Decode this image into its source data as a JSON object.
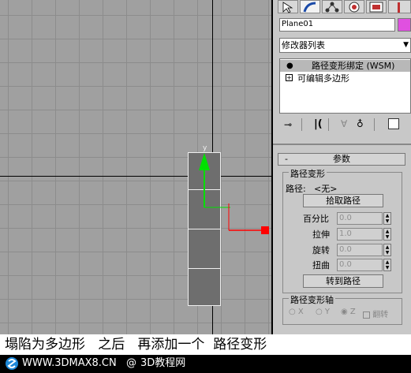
{
  "panel": {
    "object_name": "Plane01",
    "object_color": "#e050e0",
    "modifier_list_label": "修改器列表",
    "stack": [
      {
        "label": "路径变形绑定 (WSM)",
        "selected": true
      },
      {
        "label": "可编辑多边形",
        "selected": false
      }
    ],
    "rollout_title": "参数",
    "rollout_toggle": "-",
    "group_path_deform": "路径变形",
    "path_label": "路径:",
    "path_value": "<无>",
    "pick_path_button": "拾取路径",
    "percent_label": "百分比",
    "percent_value": "0.0",
    "stretch_label": "拉伸",
    "stretch_value": "1.0",
    "rotation_label": "旋转",
    "rotation_value": "0.0",
    "twist_label": "扭曲",
    "twist_value": "0.0",
    "goto_path_button": "转到路径",
    "group_axis": "路径变形轴",
    "axis_x": "X",
    "axis_y": "Y",
    "axis_z": "Z",
    "axis_selected": "Z",
    "flip_label": "翻转"
  },
  "viewport": {
    "gizmo_y_label": "y",
    "colors": {
      "y_axis": "#00e000",
      "x_axis": "#ff0000",
      "object": "#6e6e6e"
    }
  },
  "caption": "塌陷为多边形   之后   再添加一个  路径变形",
  "footer": {
    "site": "WWW.3DMAX8.CN",
    "separator": "@",
    "brand": "3D教程网"
  }
}
